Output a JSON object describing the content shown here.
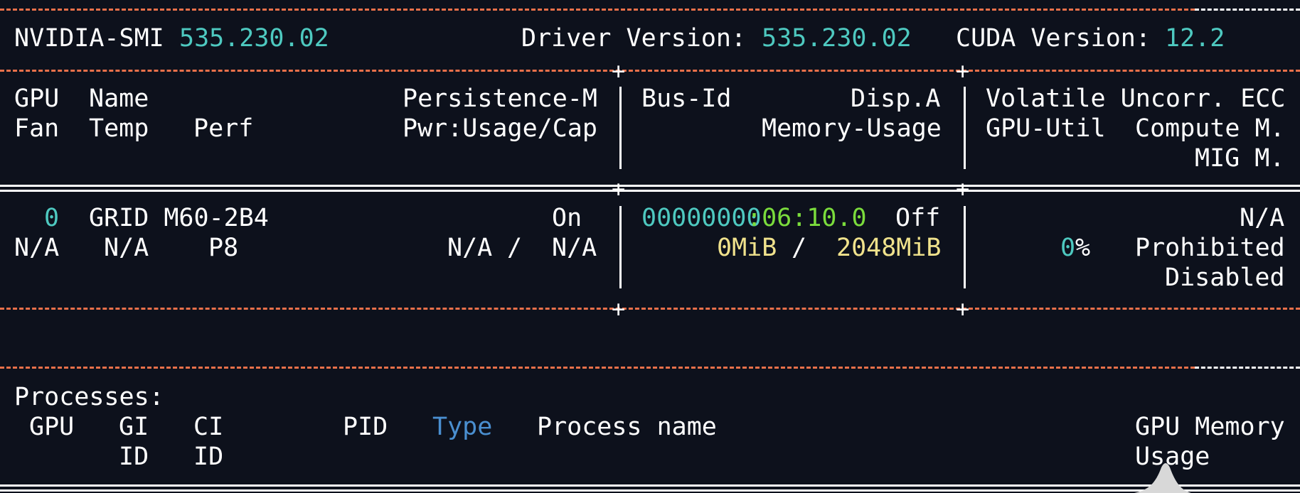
{
  "header": {
    "app_label": "NVIDIA-SMI",
    "smi_version": "535.230.02",
    "driver_label": "Driver Version:",
    "driver_version": "535.230.02",
    "cuda_label": "CUDA Version:",
    "cuda_version": "12.2"
  },
  "gpu_table": {
    "col1_header_row1": [
      "GPU",
      "Name",
      "Persistence-M"
    ],
    "col1_header_row2": [
      "Fan",
      "Temp",
      "Perf",
      "Pwr:Usage/Cap"
    ],
    "col2_header_row1": [
      "Bus-Id",
      "Disp.A"
    ],
    "col2_header_row2": "Memory-Usage",
    "col3_header_row1": "Volatile Uncorr. ECC",
    "col3_header_row2": [
      "GPU-Util",
      "Compute M."
    ],
    "col3_header_row3": "MIG M.",
    "rows": [
      {
        "gpu": "0",
        "name": "GRID M60-2B4",
        "persistence": "On",
        "fan": "N/A",
        "temp": "N/A",
        "perf": "P8",
        "pwr_usage": "N/A",
        "pwr_sep": "/",
        "pwr_cap": "N/A",
        "bus_id_prefix": "00000000",
        "bus_id_suffix": ":06:10.0",
        "disp": "Off",
        "mem_used": "0MiB",
        "mem_sep": "/",
        "mem_total": "2048MiB",
        "ecc": "N/A",
        "util_value": "0",
        "util_unit": "%",
        "compute_mode": "Prohibited",
        "mig_mode": "Disabled"
      }
    ]
  },
  "processes": {
    "title": "Processes:",
    "headers": {
      "gpu": "GPU",
      "gi": "GI",
      "gi_sub": "ID",
      "ci": "CI",
      "ci_sub": "ID",
      "pid": "PID",
      "type": "Type",
      "process_name": "Process name",
      "mem": "GPU Memory",
      "mem_sub": "Usage"
    }
  },
  "colors": {
    "background": "#0d111c",
    "dash": "#e8704a",
    "cyan": "#4ec9c0",
    "green": "#7bdc3c",
    "yellow": "#f0e28c",
    "blue": "#4a8fd0"
  }
}
